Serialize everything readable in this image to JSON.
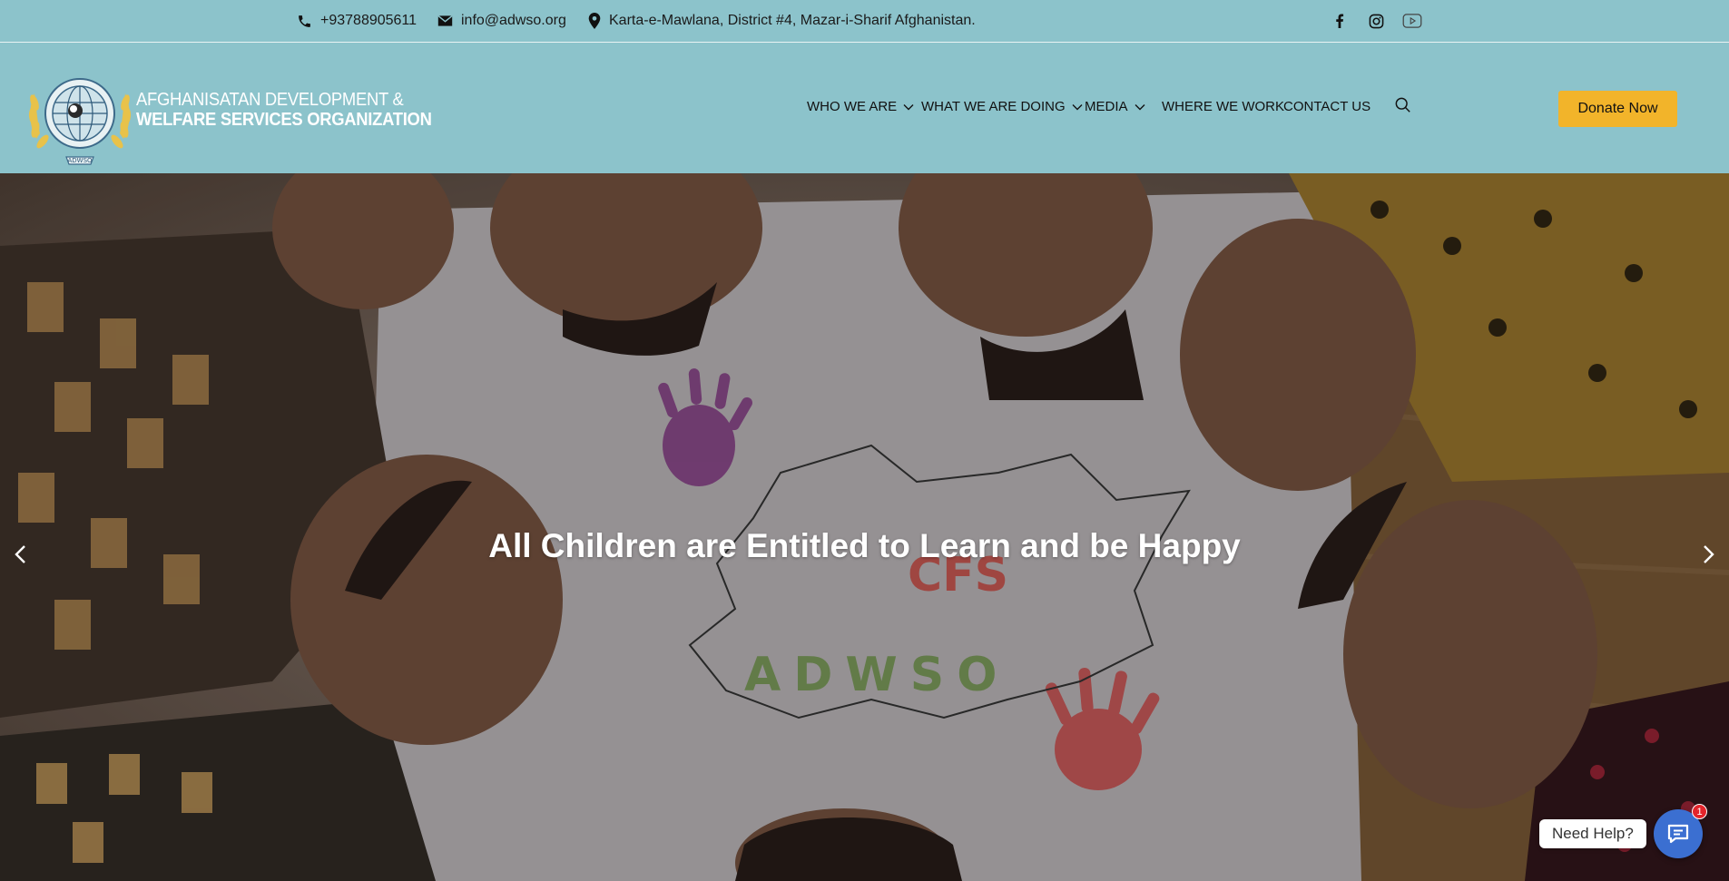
{
  "topbar": {
    "phone": "+93788905611",
    "email": "info@adwso.org",
    "address": "Karta-e-Mawlana, District #4, Mazar-i-Sharif Afghanistan.",
    "social": [
      "facebook-icon",
      "instagram-icon",
      "youtube-icon"
    ]
  },
  "brand": {
    "line1": "AFGHANISATAN DEVELOPMENT &",
    "line2": "WELFARE SERVICES ORGANIZATION",
    "logo_text": "ADWSO"
  },
  "nav": {
    "items": [
      {
        "label": "WHO WE ARE",
        "dropdown": true
      },
      {
        "label": "WHAT WE ARE DOING",
        "dropdown": true
      },
      {
        "label": "MEDIA",
        "dropdown": true
      },
      {
        "label": "WHERE WE WORK",
        "dropdown": false
      },
      {
        "label": "CONTACT US",
        "dropdown": false
      }
    ],
    "donate_label": "Donate Now"
  },
  "hero": {
    "title": "All Children are Entitled to Learn and be Happy",
    "poster_letters": "ADWSO",
    "poster_letters_top": "CFS"
  },
  "help": {
    "label": "Need Help?",
    "badge": "1"
  },
  "colors": {
    "header_bg": "#8cc3cb",
    "donate_bg": "#f2b42a",
    "help_btn": "#3b6fd1",
    "badge": "#e3242b"
  }
}
